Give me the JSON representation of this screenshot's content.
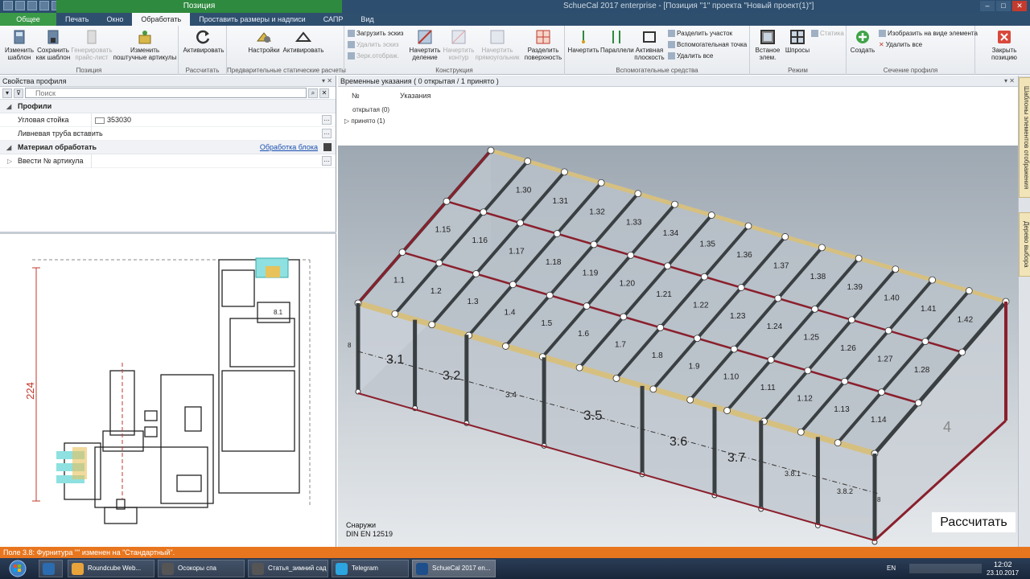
{
  "window": {
    "app_title": "SchueCal 2017 enterprise - [Позиция \"1\" проекта \"Новый проект(1)\"]",
    "context_tab": "Позиция",
    "controls": [
      "–",
      "□",
      "✕"
    ]
  },
  "tabs": [
    "Общее",
    "Печать",
    "Окно",
    "Обработать",
    "Проставить размеры и надписи",
    "САПР",
    "Вид"
  ],
  "ribbon": {
    "groups": {
      "position": {
        "caption": "Позиция",
        "change_template": "Изменить шаблон",
        "save_template": "Сохранить как шаблон",
        "gen_pricelist": "Генерировать прайс-лист",
        "change_articles": "Изменить поштучные артикулы"
      },
      "calc": {
        "caption": "Рассчитать",
        "activate": "Активировать"
      },
      "prelim": {
        "caption": "Предварительные статические расчеты",
        "settings": "Настройки",
        "activate": "Активировать"
      },
      "construction": {
        "caption": "Конструкция",
        "load_sketch": "Загрузить эскиз",
        "delete_sketch": "Удалить эскиз",
        "mirror": "Зерк.отображ.",
        "draw_division": "Начертить деление",
        "draw_contour": "Начертить контур",
        "draw_rect": "Начертить прямоугольник",
        "split_surface": "Разделить поверхность"
      },
      "aux": {
        "caption": "Вспомогательные средства",
        "draw": "Начертить",
        "parallels": "Параллели",
        "active_plane": "Активная плоскость",
        "split_section": "Разделить участок",
        "aux_point": "Вспомогательная точка",
        "delete_all": "Удалить все"
      },
      "mode": {
        "caption": "Режим",
        "inset": "Встаное элем.",
        "sprosy": "Шпросы",
        "statics": "Статика"
      },
      "section": {
        "caption": "Сечение профиля",
        "create": "Создать",
        "show_as_element": "Изобразить на виде элемента",
        "delete_all": "Удалить все"
      },
      "close": {
        "label": "Закрыть позицию"
      }
    }
  },
  "left_panel": {
    "title": "Свойства профиля",
    "search_placeholder": "Поиск",
    "profiles_header": "Профили",
    "rows": [
      {
        "key": "Угловая стойка",
        "value": "353030"
      },
      {
        "key": "Ливневая труба вставить",
        "value": ""
      }
    ],
    "material_header": "Материал обработать",
    "block_link": "Обработка блока",
    "article_row": "Ввести № артикула",
    "dimension": "224",
    "small_label": "8.1"
  },
  "temp_panel": {
    "title": "Временные указания ( 0 открытая / 1 принято )",
    "col_no": "№",
    "col_notes": "Указания",
    "open": "открытая (0)",
    "accepted": "принято (1)"
  },
  "viewport": {
    "roof_labels": [
      "1.30",
      "1.31",
      "1.32",
      "1.33",
      "1.34",
      "1.35",
      "1.36",
      "1.37",
      "1.38",
      "1.39",
      "1.40",
      "1.41",
      "1.42",
      "1.15",
      "1.16",
      "1.17",
      "1.18",
      "1.19",
      "1.20",
      "1.21",
      "1.22",
      "1.23",
      "1.24",
      "1.25",
      "1.26",
      "1.27",
      "1.28",
      "1.1",
      "1.2",
      "1.3",
      "1.4",
      "1.5",
      "1.6",
      "1.7",
      "1.8",
      "1.9",
      "1.10",
      "1.11",
      "1.12",
      "1.13",
      "1.14"
    ],
    "wall_labels": [
      "3.1",
      "3.2",
      "3.4",
      "3.5",
      "3.6",
      "3.7",
      "3.8.1",
      "3.8.2",
      "4",
      "8",
      "8"
    ],
    "side_label_outside": "Снаружи",
    "standard": "DIN EN 12519",
    "calc_button": "Рассчитать"
  },
  "side_tabs": [
    "Шаблоны элементов отображения",
    "Дерево выбора"
  ],
  "status_bar": "Поле 3.8: Фурнитура \"\" изменен на \"Стандартный\".",
  "taskbar": {
    "apps": [
      "Roundcube Web...",
      "Осокоры спа",
      "Статья_зимний сад",
      "Telegram",
      "SchueCal 2017 en..."
    ],
    "lang": "EN",
    "time": "12:02",
    "date": "23.10.2017"
  },
  "colors": {
    "accent_green": "#3a9a48",
    "status_orange": "#e8761f",
    "frame_dark": "#3a3f42",
    "frame_red": "#8a1f2c",
    "frame_gold": "#d6c080",
    "glass": "#bfc6ce"
  }
}
